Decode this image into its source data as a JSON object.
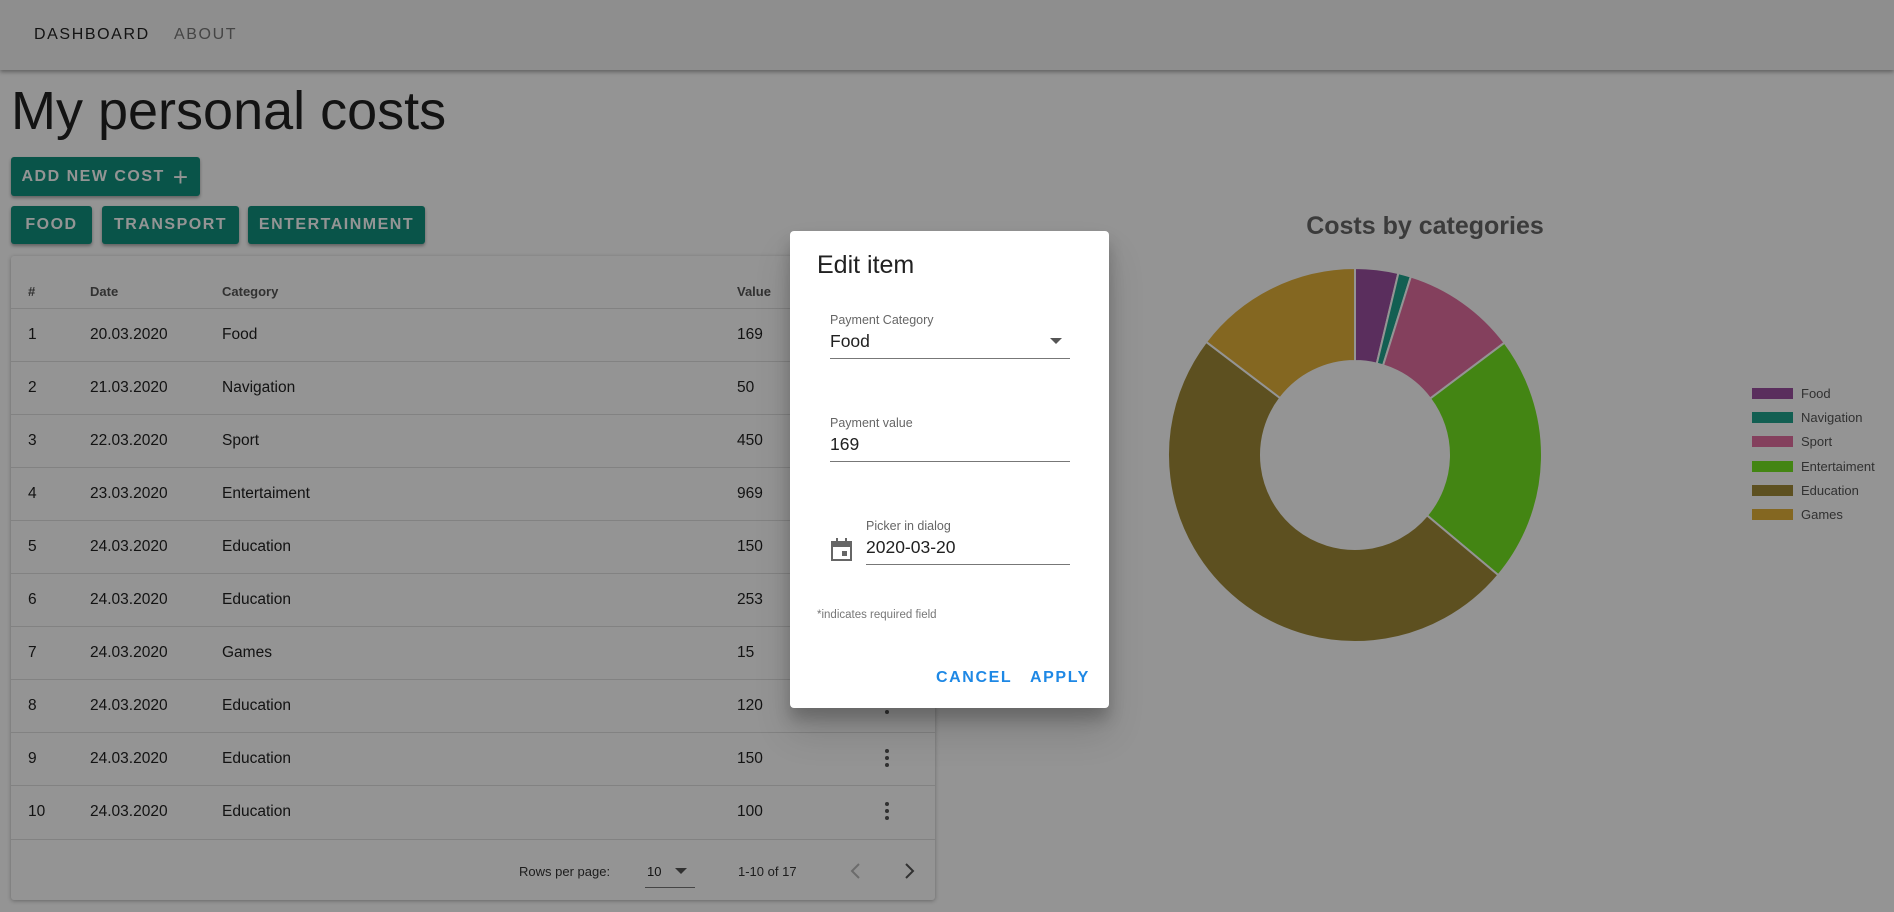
{
  "nav": {
    "tabs": [
      {
        "label": "DASHBOARD"
      },
      {
        "label": "ABOUT"
      }
    ]
  },
  "page": {
    "title": "My personal costs"
  },
  "actions": {
    "add_new_cost": "ADD NEW COST",
    "add_icon": "plus-icon",
    "filters": [
      {
        "label": "FOOD"
      },
      {
        "label": "TRANSPORT"
      },
      {
        "label": "ENTERTAINMENT"
      }
    ]
  },
  "table": {
    "headers": {
      "num": "#",
      "date": "Date",
      "category": "Category",
      "value": "Value"
    },
    "rows": [
      {
        "num": "1",
        "date": "20.03.2020",
        "category": "Food",
        "value": "169"
      },
      {
        "num": "2",
        "date": "21.03.2020",
        "category": "Navigation",
        "value": "50"
      },
      {
        "num": "3",
        "date": "22.03.2020",
        "category": "Sport",
        "value": "450"
      },
      {
        "num": "4",
        "date": "23.03.2020",
        "category": "Entertaiment",
        "value": "969"
      },
      {
        "num": "5",
        "date": "24.03.2020",
        "category": "Education",
        "value": "150"
      },
      {
        "num": "6",
        "date": "24.03.2020",
        "category": "Education",
        "value": "253"
      },
      {
        "num": "7",
        "date": "24.03.2020",
        "category": "Games",
        "value": "15"
      },
      {
        "num": "8",
        "date": "24.03.2020",
        "category": "Education",
        "value": "120"
      },
      {
        "num": "9",
        "date": "24.03.2020",
        "category": "Education",
        "value": "150"
      },
      {
        "num": "10",
        "date": "24.03.2020",
        "category": "Education",
        "value": "100"
      }
    ],
    "pagination": {
      "rows_per_page_label": "Rows per page:",
      "rows_per_page_value": "10",
      "range": "1-10 of 17"
    }
  },
  "chart_data": {
    "type": "pie",
    "title": "Costs by categories",
    "categories": [
      "Food",
      "Navigation",
      "Sport",
      "Entertaiment",
      "Education",
      "Games"
    ],
    "legend_labels": [
      "Food",
      "Navigation",
      "Sport",
      "Entertaiment",
      "Education",
      "Games"
    ],
    "values": [
      169,
      50,
      450,
      969,
      2234,
      665
    ],
    "colors": [
      "#9c50a0",
      "#20a48e",
      "#e36fa0",
      "#74e521",
      "#a08b37",
      "#e3b23a"
    ],
    "donut": true,
    "legend_position": "right"
  },
  "dialog": {
    "title": "Edit item",
    "category_label": "Payment Category",
    "category_value": "Food",
    "value_label": "Payment value",
    "value_value": "169",
    "date_label": "Picker in dialog",
    "date_value": "2020-03-20",
    "required_note": "*indicates required field",
    "cancel": "CANCEL",
    "apply": "APPLY",
    "calendar_icon": "calendar-icon",
    "dropdown_icon": "chevron-down-icon"
  },
  "colors": {
    "accent": "#11917e",
    "dialog_action": "#1e88e5"
  }
}
